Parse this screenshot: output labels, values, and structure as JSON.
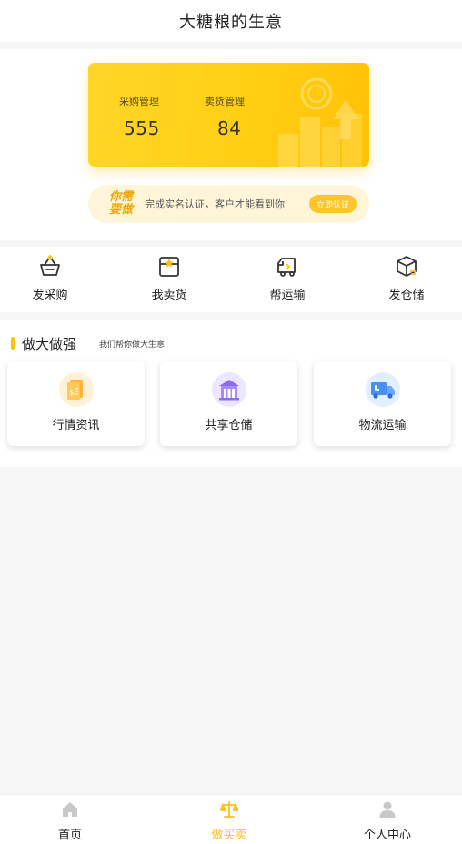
{
  "header": {
    "title": "大糖粮的生意"
  },
  "stats": {
    "purchase": {
      "label": "采购管理",
      "value": "555"
    },
    "sales": {
      "label": "卖货管理",
      "value": "84"
    }
  },
  "certification": {
    "logo_line1": "你需",
    "logo_line2": "要做",
    "text": "完成实名认证，客户才能看到你",
    "button": "立即认证"
  },
  "quick_nav": [
    {
      "label": "发采购",
      "icon": "basket-icon"
    },
    {
      "label": "我卖货",
      "icon": "box-star-icon"
    },
    {
      "label": "帮运输",
      "icon": "truck-outline-icon"
    },
    {
      "label": "发仓储",
      "icon": "package-icon"
    }
  ],
  "section": {
    "title": "做大做强",
    "subtitle": "我们帮你做大生意"
  },
  "services": [
    {
      "label": "行情资讯",
      "icon": "document-money-icon"
    },
    {
      "label": "共享仓储",
      "icon": "warehouse-icon"
    },
    {
      "label": "物流运输",
      "icon": "delivery-truck-icon"
    }
  ],
  "tabbar": [
    {
      "label": "首页",
      "icon": "home-icon",
      "active": false
    },
    {
      "label": "做买卖",
      "icon": "scale-icon",
      "active": true
    },
    {
      "label": "个人中心",
      "icon": "person-icon",
      "active": false
    }
  ],
  "colors": {
    "accent": "#ffc107",
    "accent_text": "#ffbe1a",
    "card_gradient_start": "#ffd628",
    "card_gradient_end": "#ffc107",
    "banner_bg": "#fff6da"
  }
}
